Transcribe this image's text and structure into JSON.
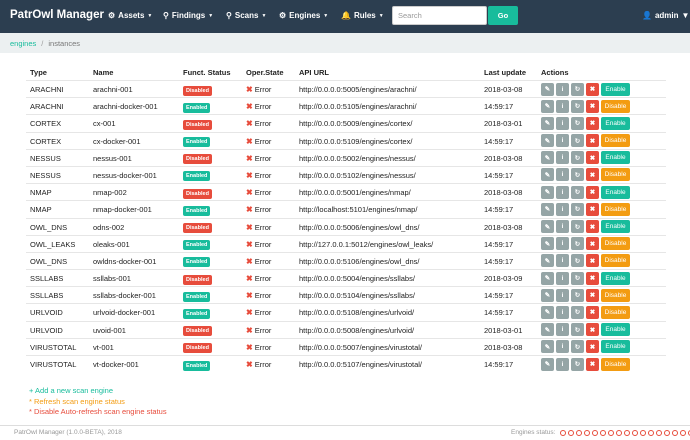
{
  "navbar": {
    "brand": "PatrOwl Manager",
    "menus": [
      {
        "label": "Assets",
        "icon": "gear-icon"
      },
      {
        "label": "Findings",
        "icon": "map-marker-icon"
      },
      {
        "label": "Scans",
        "icon": "search-icon"
      },
      {
        "label": "Engines",
        "icon": "gears-icon"
      },
      {
        "label": "Rules",
        "icon": "bell-icon"
      }
    ],
    "search_placeholder": "Search",
    "search_button": "Go",
    "user": "admin"
  },
  "breadcrumb": {
    "link": "engines",
    "current": "instances"
  },
  "table": {
    "headers": {
      "type": "Type",
      "name": "Name",
      "func": "Funct. Status",
      "oper": "Oper.State",
      "url": "API URL",
      "updated": "Last update",
      "actions": "Actions"
    },
    "oper_state_label": "Error",
    "rows": [
      {
        "type": "ARACHNI",
        "name": "arachni-001",
        "func": "Disabled",
        "url": "http://0.0.0.0:5005/engines/arachni/",
        "updated": "2018-03-08",
        "toggle": "Enable"
      },
      {
        "type": "ARACHNI",
        "name": "arachni-docker-001",
        "func": "Enabled",
        "url": "http://0.0.0.0:5105/engines/arachni/",
        "updated": "14:59:17",
        "toggle": "Disable"
      },
      {
        "type": "CORTEX",
        "name": "cx-001",
        "func": "Disabled",
        "url": "http://0.0.0.0:5009/engines/cortex/",
        "updated": "2018-03-01",
        "toggle": "Enable"
      },
      {
        "type": "CORTEX",
        "name": "cx-docker-001",
        "func": "Enabled",
        "url": "http://0.0.0.0:5109/engines/cortex/",
        "updated": "14:59:17",
        "toggle": "Disable"
      },
      {
        "type": "NESSUS",
        "name": "nessus-001",
        "func": "Disabled",
        "url": "http://0.0.0.0:5002/engines/nessus/",
        "updated": "2018-03-08",
        "toggle": "Enable"
      },
      {
        "type": "NESSUS",
        "name": "nessus-docker-001",
        "func": "Enabled",
        "url": "http://0.0.0.0:5102/engines/nessus/",
        "updated": "14:59:17",
        "toggle": "Disable"
      },
      {
        "type": "NMAP",
        "name": "nmap-002",
        "func": "Disabled",
        "url": "http://0.0.0.0:5001/engines/nmap/",
        "updated": "2018-03-08",
        "toggle": "Enable"
      },
      {
        "type": "NMAP",
        "name": "nmap-docker-001",
        "func": "Enabled",
        "url": "http://localhost:5101/engines/nmap/",
        "updated": "14:59:17",
        "toggle": "Disable"
      },
      {
        "type": "OWL_DNS",
        "name": "odns-002",
        "func": "Disabled",
        "url": "http://0.0.0.0:5006/engines/owl_dns/",
        "updated": "2018-03-08",
        "toggle": "Enable"
      },
      {
        "type": "OWL_LEAKS",
        "name": "oleaks-001",
        "func": "Enabled",
        "url": "http://127.0.0.1:5012/engines/owl_leaks/",
        "updated": "14:59:17",
        "toggle": "Disable"
      },
      {
        "type": "OWL_DNS",
        "name": "owldns-docker-001",
        "func": "Enabled",
        "url": "http://0.0.0.0:5106/engines/owl_dns/",
        "updated": "14:59:17",
        "toggle": "Disable"
      },
      {
        "type": "SSLLABS",
        "name": "ssllabs-001",
        "func": "Disabled",
        "url": "http://0.0.0.0:5004/engines/ssllabs/",
        "updated": "2018-03-09",
        "toggle": "Enable"
      },
      {
        "type": "SSLLABS",
        "name": "ssllabs-docker-001",
        "func": "Enabled",
        "url": "http://0.0.0.0:5104/engines/ssllabs/",
        "updated": "14:59:17",
        "toggle": "Disable"
      },
      {
        "type": "URLVOID",
        "name": "urlvoid-docker-001",
        "func": "Enabled",
        "url": "http://0.0.0.0:5108/engines/urlvoid/",
        "updated": "14:59:17",
        "toggle": "Disable"
      },
      {
        "type": "URLVOID",
        "name": "uvoid-001",
        "func": "Disabled",
        "url": "http://0.0.0.0:5008/engines/urlvoid/",
        "updated": "2018-03-01",
        "toggle": "Enable"
      },
      {
        "type": "VIRUSTOTAL",
        "name": "vt-001",
        "func": "Disabled",
        "url": "http://0.0.0.0:5007/engines/virustotal/",
        "updated": "2018-03-08",
        "toggle": "Enable"
      },
      {
        "type": "VIRUSTOTAL",
        "name": "vt-docker-001",
        "func": "Enabled",
        "url": "http://0.0.0.0:5107/engines/virustotal/",
        "updated": "14:59:17",
        "toggle": "Disable"
      }
    ]
  },
  "links": {
    "add": "+ Add a new scan engine",
    "refresh": "* Refresh scan engine status",
    "disable_auto": "* Disable Auto-refresh scan engine status"
  },
  "footer": {
    "version": "PatrOwl Manager (1.0.0-BETA), 2018",
    "status_label": "Engines status:",
    "status_dot_count": 17
  },
  "colors": {
    "navbar": "#2c3e50",
    "accent": "#18bc9c",
    "danger": "#e74c3c",
    "warning": "#f39c12",
    "action_gray": "#95a5a6"
  }
}
